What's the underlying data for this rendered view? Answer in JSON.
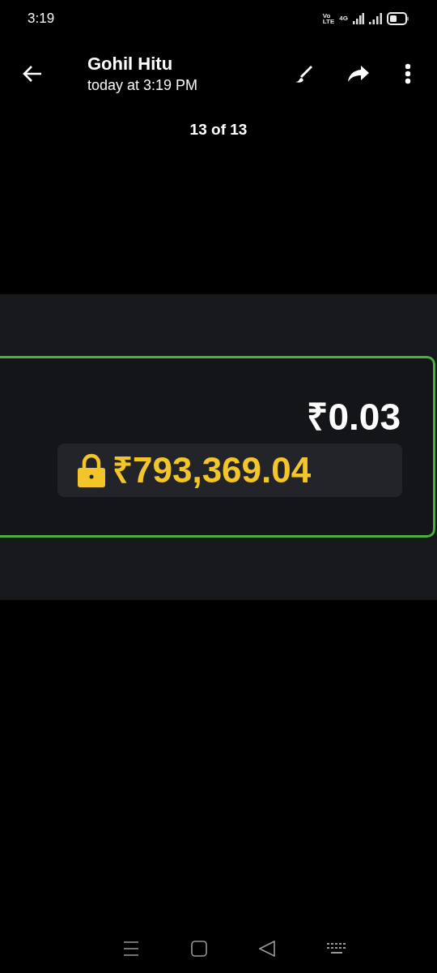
{
  "status_bar": {
    "time": "3:19",
    "volte": [
      "Vo",
      "LTE"
    ],
    "network": "4G"
  },
  "header": {
    "title": "Gohil Hitu",
    "subtitle": "today at 3:19 PM"
  },
  "counter": "13 of 13",
  "image": {
    "balance": "₹0.03",
    "locked_balance": "₹793,369.04"
  }
}
